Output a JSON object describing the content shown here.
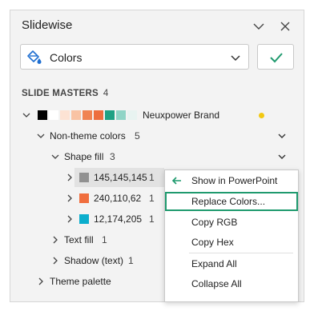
{
  "pane": {
    "title": "Slidewise",
    "selector": {
      "value": "Colors",
      "icon": "paint-bucket-icon"
    },
    "apply_icon": "check-icon"
  },
  "section": {
    "label": "SLIDE MASTERS",
    "count": "4"
  },
  "master": {
    "name": "Neuxpower Brand",
    "swatches": [
      "#000000",
      "#ffffff",
      "#fde3d4",
      "#f9c3a4",
      "#f08453",
      "#ed6e3e",
      "#1fa184",
      "#8fd4c6",
      "#e8f3f1"
    ],
    "indicator_color": "#f2c811"
  },
  "tree": {
    "non_theme": {
      "label": "Non-theme colors",
      "count": "5"
    },
    "shape_fill": {
      "label": "Shape fill",
      "count": "3"
    },
    "colors": [
      {
        "label": "145,145,145",
        "count": "1",
        "color": "#919191"
      },
      {
        "label": "240,110,62",
        "count": "1",
        "color": "#f06e3e"
      },
      {
        "label": "12,174,205",
        "count": "1",
        "color": "#0caecd"
      }
    ],
    "text_fill": {
      "label": "Text fill",
      "count": "1"
    },
    "shadow_text": {
      "label": "Shadow (text)",
      "count": "1"
    },
    "theme_palette": {
      "label": "Theme palette"
    }
  },
  "context_menu": {
    "items": [
      {
        "label": "Show in PowerPoint",
        "icon": "arrow-left-icon"
      },
      {
        "label": "Replace Colors..."
      },
      {
        "label": "Copy RGB"
      },
      {
        "label": "Copy Hex"
      },
      {
        "label": "Expand All"
      },
      {
        "label": "Collapse All"
      }
    ]
  }
}
